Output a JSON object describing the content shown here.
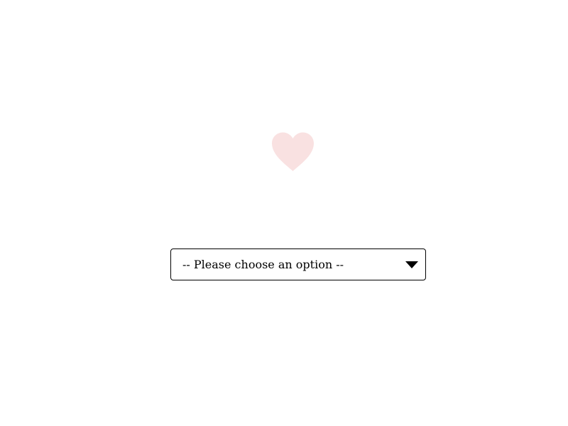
{
  "heart": {
    "icon": "heart-icon",
    "color": "#f9e1e1"
  },
  "dropdown": {
    "selected_label": "-- Please choose an option --",
    "arrow_icon": "caret-down-icon",
    "border_color": "#000000"
  }
}
